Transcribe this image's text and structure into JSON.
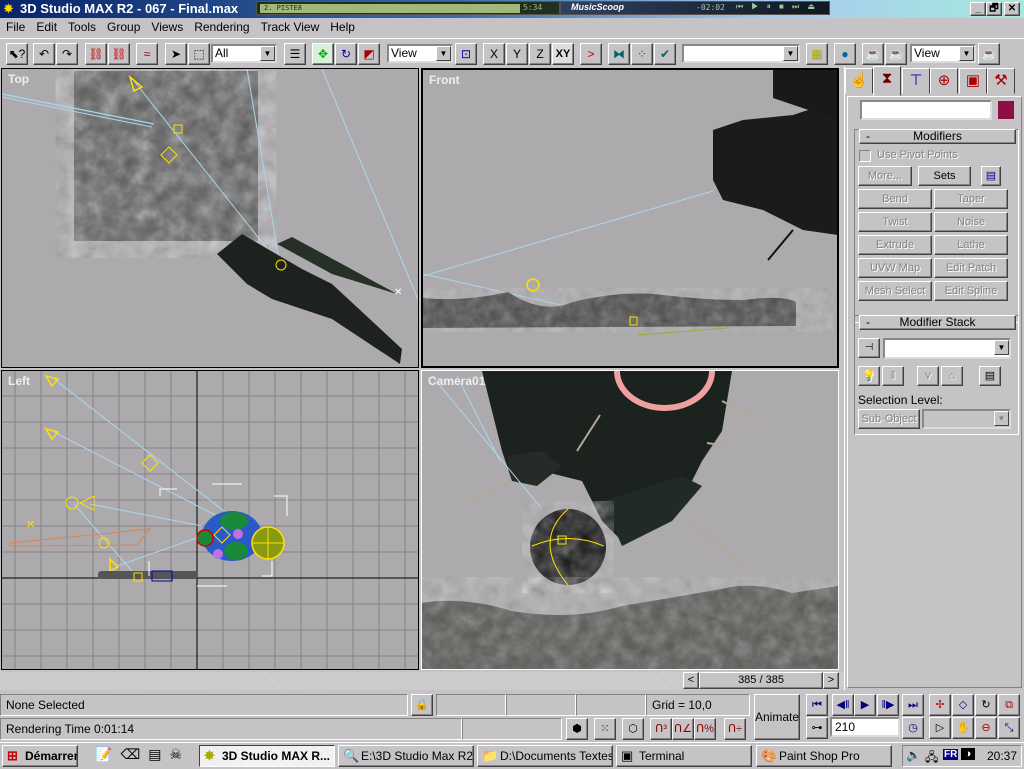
{
  "window": {
    "title": "3D Studio MAX R2 - 067 - Final.max",
    "buttons": {
      "minimize": "_",
      "maximize": "🗗",
      "close": "✕"
    }
  },
  "winamp": {
    "track": "2. PISTE8",
    "time": "5:34"
  },
  "musicscoop": {
    "label": "MusicScoop",
    "time": "-02:02",
    "controls": "⏮ ▶ ⏸ ■ ⏭ ⏏"
  },
  "menu": [
    "File",
    "Edit",
    "Tools",
    "Group",
    "Views",
    "Rendering",
    "Track View",
    "Help"
  ],
  "toolbar": {
    "selection_filter": "All",
    "ref_coord_system": "View",
    "axis_constraints": [
      "X",
      "Y",
      "Z",
      "XY"
    ],
    "named_selection": "",
    "render_type": "View",
    "icons": [
      "help-icon",
      "undo-icon",
      "redo-icon",
      "link-icon",
      "unlink-icon",
      "bind-spacewarp-icon",
      "select-icon",
      "region-select-icon",
      "select-by-name-icon",
      "move-icon",
      "rotate-icon",
      "scale-icon",
      "pivot-icon",
      "mirror-icon",
      "array-icon",
      "align-icon",
      "track-view-icon",
      "material-editor-icon",
      "render-scene-icon",
      "quick-render-icon",
      "render-last-icon"
    ]
  },
  "viewports": {
    "top": {
      "label": "Top"
    },
    "front": {
      "label": "Front"
    },
    "left": {
      "label": "Left"
    },
    "camera": {
      "label": "Camera01"
    }
  },
  "command_panel": {
    "tabs": [
      "create-tab",
      "modify-tab",
      "hierarchy-tab",
      "motion-tab",
      "display-tab",
      "utilities-tab"
    ],
    "active_tab": "modify-tab",
    "object_name": "",
    "object_color": "#8c1046",
    "modifiers": {
      "title": "Modifiers",
      "use_pivot_points": "Use Pivot Points",
      "more": "More...",
      "sets": "Sets",
      "buttons": [
        "Bend",
        "Taper",
        "Twist",
        "Noise",
        "Extrude",
        "Lathe",
        "UVW Map",
        "Edit Patch",
        "Mesh Select",
        "Edit Spline"
      ]
    },
    "modifier_stack": {
      "title": "Modifier Stack",
      "stack_value": "",
      "selection_level_label": "Selection Level:",
      "sub_object": "Sub-Object",
      "sub_object_value": ""
    }
  },
  "time_slider": {
    "label": "385 / 385",
    "current": 385,
    "total": 385,
    "prev": "<",
    "next": ">"
  },
  "status": {
    "selection": "None Selected",
    "prompt": "Rendering Time  0:01:14",
    "grid": "Grid = 10,0"
  },
  "animation": {
    "animate_label": "Animate",
    "current_frame": "210"
  },
  "taskbar": {
    "start": "Démarrer",
    "tasks": [
      {
        "label": "3D Studio MAX R...",
        "active": true
      },
      {
        "label": "E:\\3D Studio Max R2...",
        "active": false
      },
      {
        "label": "D:\\Documents Textes",
        "active": false
      },
      {
        "label": "Terminal",
        "active": false
      },
      {
        "label": "Paint Shop Pro",
        "active": false
      }
    ],
    "tray": {
      "language": "FR",
      "clock": "20:37"
    }
  }
}
